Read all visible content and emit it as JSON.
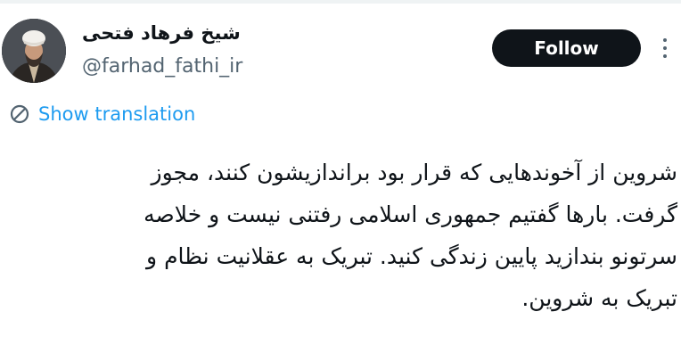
{
  "author": {
    "display_name": "شیخ فرهاد فتحی",
    "handle": "@farhad_fathi_ir"
  },
  "actions": {
    "follow_label": "Follow",
    "more_icon": "more-vertical-icon"
  },
  "translation": {
    "label": "Show translation",
    "icon": "translate-icon",
    "color": "#1d9bf0"
  },
  "tweet": {
    "lines": [
      "شروین از آخوندهایی که قرار بود براندازیشون کنند، مجوز",
      "گرفت. بارها گفتیم جمهوری اسلامی رفتنی نیست و خلاصه",
      "سرتونو بندازید پایین زندگی کنید.  تبریک به عقلانیت نظام و",
      "تبریک به شروین."
    ]
  },
  "colors": {
    "text": "#0f1419",
    "secondary": "#536471",
    "button_bg": "#0f1419",
    "button_text": "#ffffff"
  }
}
